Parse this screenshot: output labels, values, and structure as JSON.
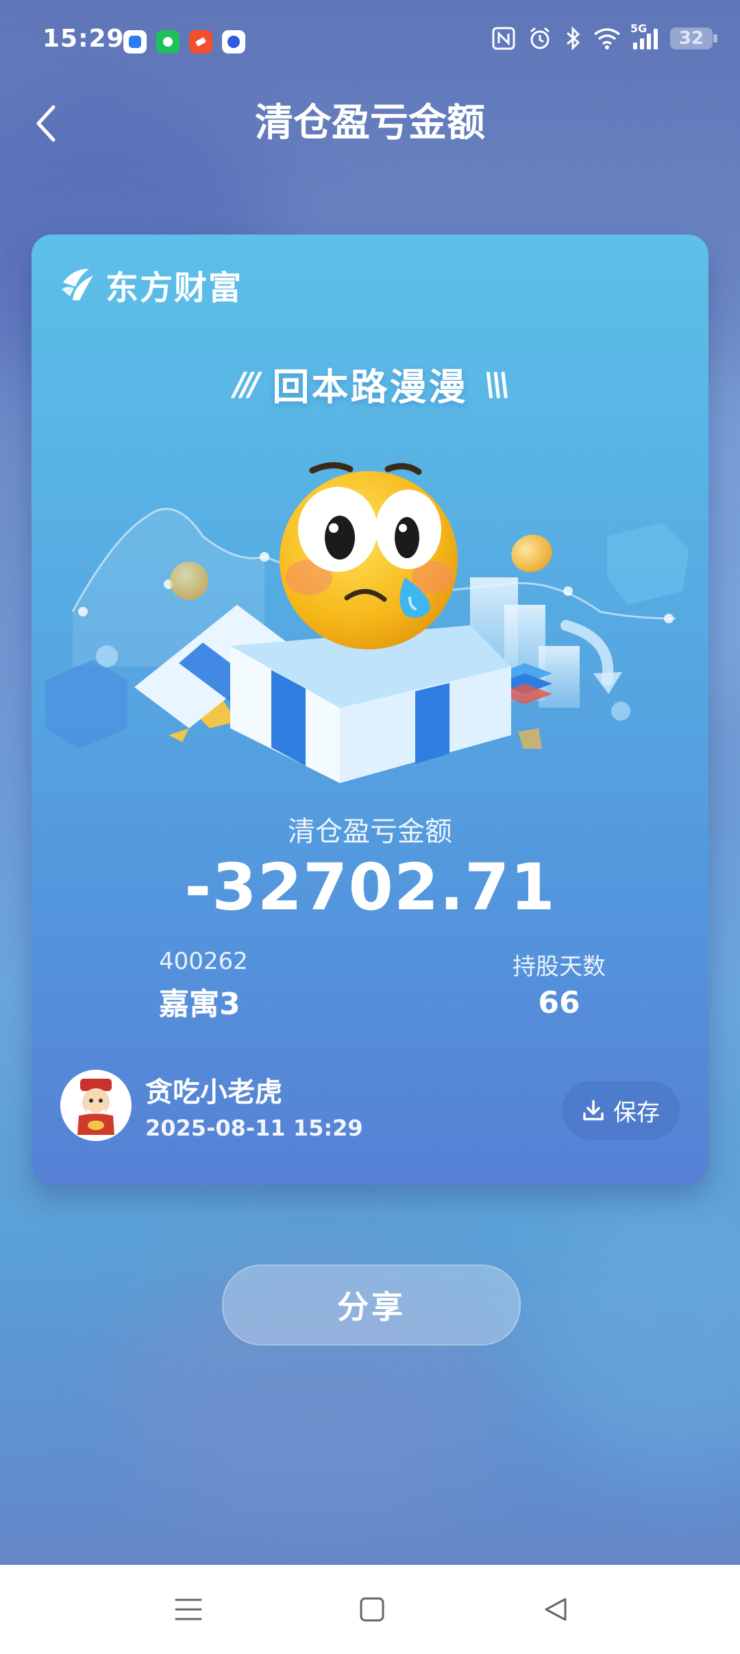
{
  "status_bar": {
    "time": "15:29",
    "app_icons": [
      {
        "name": "browser-app-icon",
        "color": "#2d7cf6"
      },
      {
        "name": "green-app-icon",
        "color": "#1fc15a"
      },
      {
        "name": "red-app-icon",
        "color": "#f0502d"
      },
      {
        "name": "baidu-app-icon",
        "color": "#3057e1"
      }
    ],
    "indicators": [
      "nfc-icon",
      "alarm-icon",
      "bluetooth-icon",
      "wifi-icon",
      "5g-signal-icon"
    ],
    "network": "5G",
    "battery": "32"
  },
  "header": {
    "title": "清仓盈亏金额",
    "back_icon": "chevron-left-icon"
  },
  "card": {
    "brand_name": "东方财富",
    "slogan": "回本路漫漫",
    "slogan_decor_left": "///",
    "slogan_decor_right": "\\\\\\",
    "amount_label": "清仓盈亏金额",
    "amount_value": "-32702.71",
    "stock_code": "400262",
    "stock_name": "嘉寓3",
    "days_label": "持股天数",
    "days_value": "66",
    "user_name": "贪吃小老虎",
    "timestamp": "2025-08-11 15:29",
    "save_label": "保存"
  },
  "share_label": "分享",
  "colors": {
    "accent": "#5496dd",
    "emoji_face": "#f7c21e",
    "tear": "#3fb6ef"
  },
  "nav": {
    "menu_icon": "menu-icon",
    "home_icon": "square-home-icon",
    "back_icon": "triangle-back-icon"
  }
}
